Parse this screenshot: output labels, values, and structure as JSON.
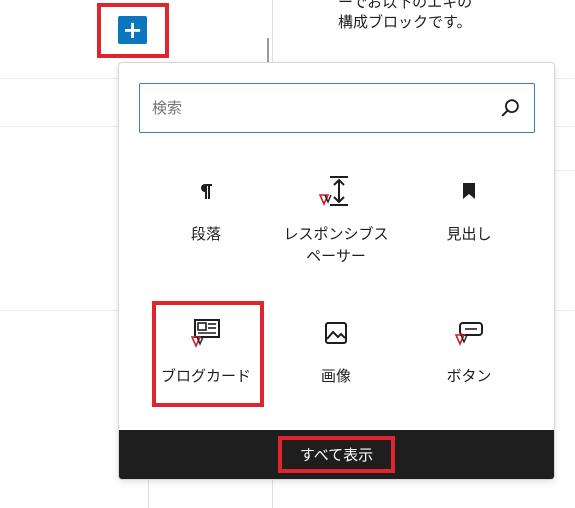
{
  "background": {
    "text_lines": [
      "ーでお以下のエキの",
      "構成ブロックです。"
    ]
  },
  "toolbar": {
    "add_block_glyph": "+"
  },
  "inserter": {
    "search": {
      "placeholder": "検索",
      "value": ""
    },
    "blocks": [
      {
        "label": "段落",
        "icon": "paragraph-icon"
      },
      {
        "label": "レスポンシブスペーサー",
        "icon": "spacer-icon"
      },
      {
        "label": "見出し",
        "icon": "heading-bookmark-icon"
      },
      {
        "label": "ブログカード",
        "icon": "blog-card-icon"
      },
      {
        "label": "画像",
        "icon": "image-icon"
      },
      {
        "label": "ボタン",
        "icon": "button-icon"
      }
    ],
    "browse_all_label": "すべて表示"
  },
  "colors": {
    "accent": "#0a76bd",
    "highlight": "#e1252f",
    "footer_bg": "#1e1e1e",
    "icon_badge": "#cc1f2b"
  }
}
